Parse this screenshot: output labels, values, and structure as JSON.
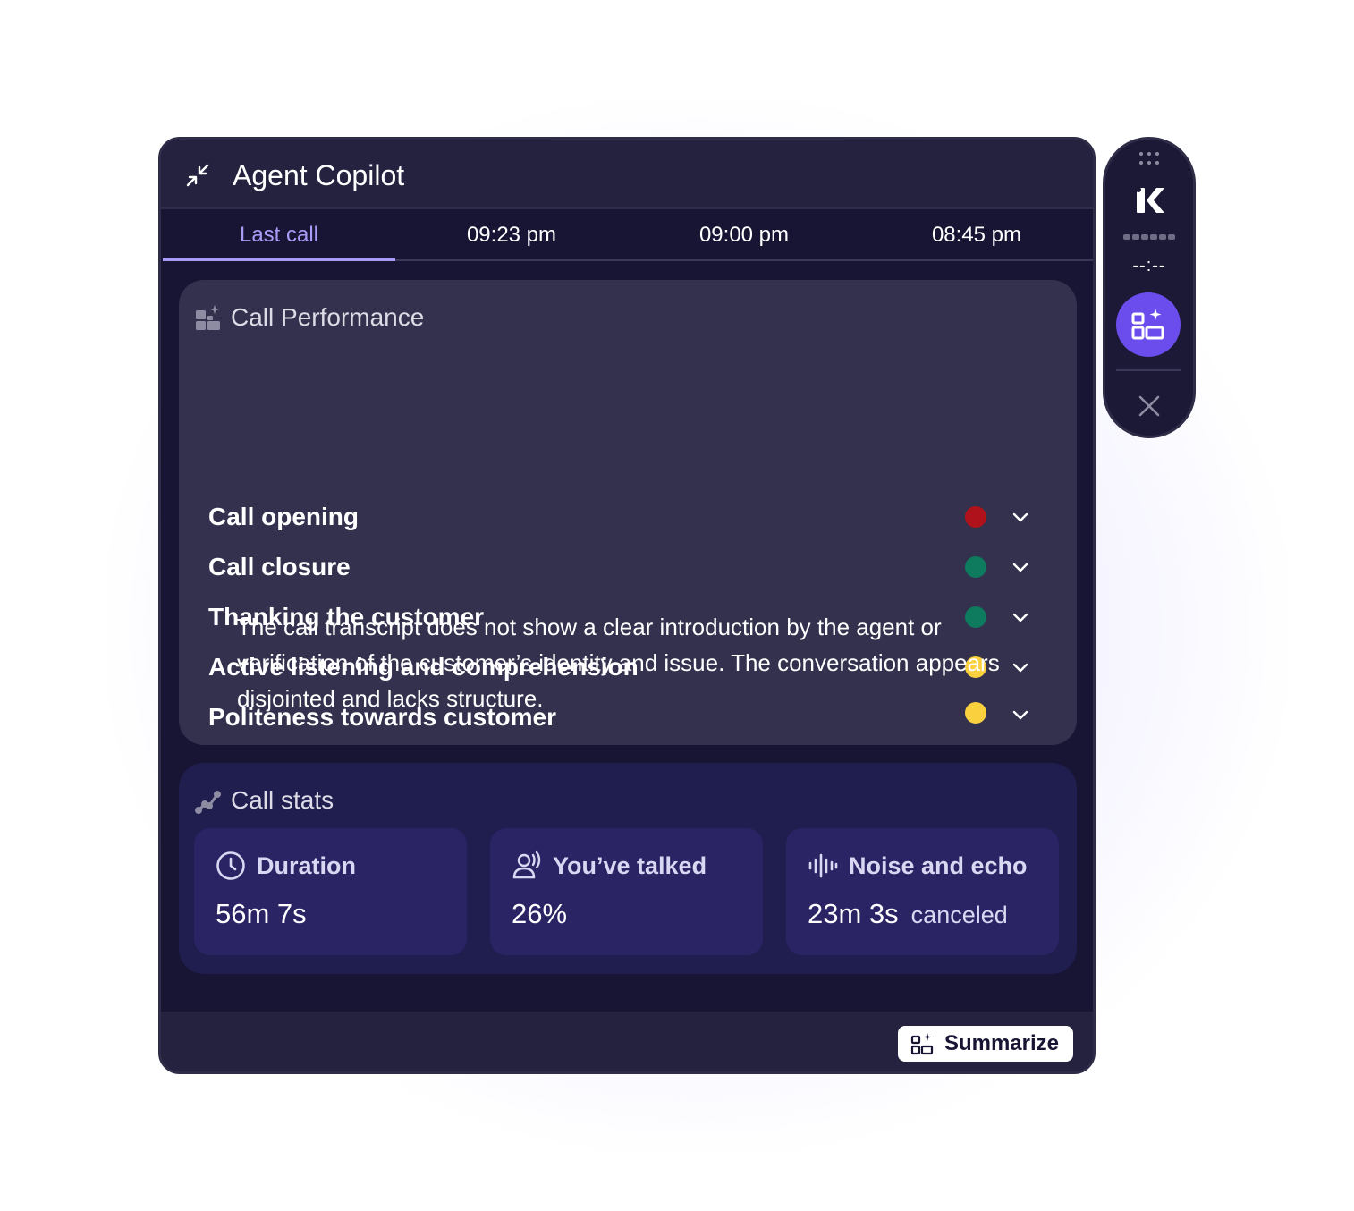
{
  "header": {
    "title": "Agent Copilot"
  },
  "tabs": [
    {
      "label": "Last call",
      "active": true
    },
    {
      "label": "09:23 pm",
      "active": false
    },
    {
      "label": "09:00 pm",
      "active": false
    },
    {
      "label": "08:45 pm",
      "active": false
    }
  ],
  "performance": {
    "title": "Call Performance",
    "items": [
      {
        "label": "Call opening",
        "status_color": "#b0121b"
      },
      {
        "label": "Call closure",
        "status_color": "#0e7a5e"
      },
      {
        "label": "Thanking the customer",
        "status_color": "#0e7a5e"
      },
      {
        "label": "Active listening and comprehension",
        "status_color": "#fbd03f"
      },
      {
        "label": "Politeness towards customer",
        "status_color": "#fbd03f"
      }
    ],
    "description": "The call transcript does not show a clear introduction by the agent or verification of the customer’s identity and issue. The conversation appears disjointed and lacks structure."
  },
  "stats": {
    "title": "Call stats",
    "duration": {
      "label": "Duration",
      "value": "56m 7s"
    },
    "talked": {
      "label": "You’ve talked",
      "value": "26%"
    },
    "noise": {
      "label": "Noise and echo",
      "value": "23m 3s",
      "sub": "canceled"
    }
  },
  "footer": {
    "summarize_label": "Summarize"
  },
  "dock": {
    "timer": "--:--"
  },
  "colors": {
    "accent": "#a99bf7",
    "primary": "#6b4dee",
    "panel_bg": "#171533"
  },
  "icons": [
    "collapse-icon",
    "ai-widgets-icon",
    "chart-line-icon",
    "clock-icon",
    "speaking-icon",
    "soundwave-icon",
    "grip-icon",
    "logo-icon",
    "close-icon",
    "chevron-down-icon"
  ]
}
